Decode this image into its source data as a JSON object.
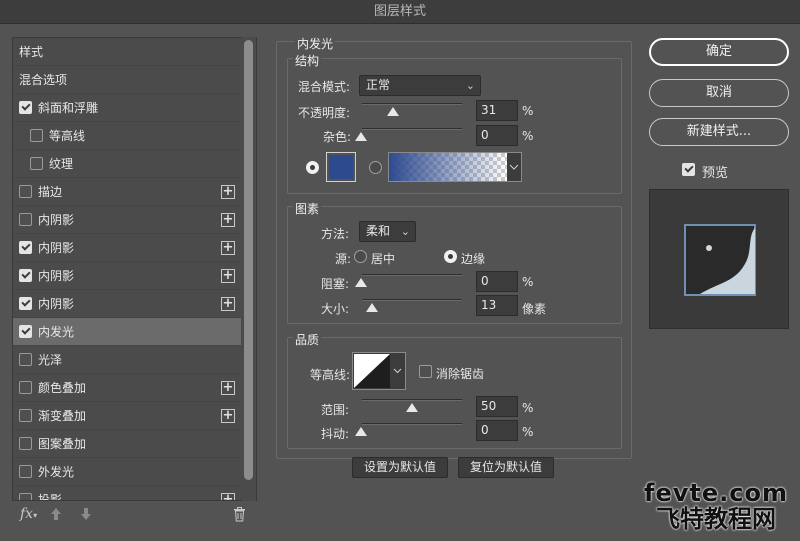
{
  "window": {
    "title": "图层样式"
  },
  "style_list": {
    "items": [
      {
        "label": "样式",
        "checkbox": false,
        "checked": false,
        "indent": false,
        "plus": false,
        "selected": false
      },
      {
        "label": "混合选项",
        "checkbox": false,
        "checked": false,
        "indent": false,
        "plus": false,
        "selected": false
      },
      {
        "label": "斜面和浮雕",
        "checkbox": true,
        "checked": true,
        "indent": false,
        "plus": false,
        "selected": false
      },
      {
        "label": "等高线",
        "checkbox": true,
        "checked": false,
        "indent": true,
        "plus": false,
        "selected": false
      },
      {
        "label": "纹理",
        "checkbox": true,
        "checked": false,
        "indent": true,
        "plus": false,
        "selected": false
      },
      {
        "label": "描边",
        "checkbox": true,
        "checked": false,
        "indent": false,
        "plus": true,
        "selected": false
      },
      {
        "label": "内阴影",
        "checkbox": true,
        "checked": false,
        "indent": false,
        "plus": true,
        "selected": false
      },
      {
        "label": "内阴影",
        "checkbox": true,
        "checked": true,
        "indent": false,
        "plus": true,
        "selected": false
      },
      {
        "label": "内阴影",
        "checkbox": true,
        "checked": true,
        "indent": false,
        "plus": true,
        "selected": false
      },
      {
        "label": "内阴影",
        "checkbox": true,
        "checked": true,
        "indent": false,
        "plus": true,
        "selected": false
      },
      {
        "label": "内发光",
        "checkbox": true,
        "checked": true,
        "indent": false,
        "plus": false,
        "selected": true
      },
      {
        "label": "光泽",
        "checkbox": true,
        "checked": false,
        "indent": false,
        "plus": false,
        "selected": false
      },
      {
        "label": "颜色叠加",
        "checkbox": true,
        "checked": false,
        "indent": false,
        "plus": true,
        "selected": false
      },
      {
        "label": "渐变叠加",
        "checkbox": true,
        "checked": false,
        "indent": false,
        "plus": true,
        "selected": false
      },
      {
        "label": "图案叠加",
        "checkbox": true,
        "checked": false,
        "indent": false,
        "plus": false,
        "selected": false
      },
      {
        "label": "外发光",
        "checkbox": true,
        "checked": false,
        "indent": false,
        "plus": false,
        "selected": false
      },
      {
        "label": "投影",
        "checkbox": true,
        "checked": false,
        "indent": false,
        "plus": true,
        "selected": false
      }
    ],
    "bottom": {
      "fx_label": "fx"
    }
  },
  "inner_glow": {
    "title": "内发光",
    "structure": {
      "title": "结构",
      "blend_mode_label": "混合模式:",
      "blend_mode_value": "正常",
      "opacity_label": "不透明度:",
      "opacity_value": "31",
      "opacity_unit": "%",
      "noise_label": "杂色:",
      "noise_value": "0",
      "noise_unit": "%",
      "glow_color": "#2e4a8f",
      "color_mode": "solid"
    },
    "elements": {
      "title": "图素",
      "method_label": "方法:",
      "method_value": "柔和",
      "source_label": "源:",
      "source_center_label": "居中",
      "source_edge_label": "边缘",
      "source_value": "edge",
      "choke_label": "阻塞:",
      "choke_value": "0",
      "choke_unit": "%",
      "size_label": "大小:",
      "size_value": "13",
      "size_unit": "像素"
    },
    "quality": {
      "title": "品质",
      "contour_label": "等高线:",
      "anti_alias_label": "消除锯齿",
      "anti_alias_checked": false,
      "range_label": "范围:",
      "range_value": "50",
      "range_unit": "%",
      "jitter_label": "抖动:",
      "jitter_value": "0",
      "jitter_unit": "%"
    },
    "set_default_label": "设置为默认值",
    "reset_default_label": "复位为默认值"
  },
  "actions": {
    "ok_label": "确定",
    "cancel_label": "取消",
    "new_style_label": "新建样式...",
    "preview_label": "预览",
    "preview_checked": true
  },
  "watermark": {
    "line1": "fevte.com",
    "line2": "飞特教程网"
  }
}
